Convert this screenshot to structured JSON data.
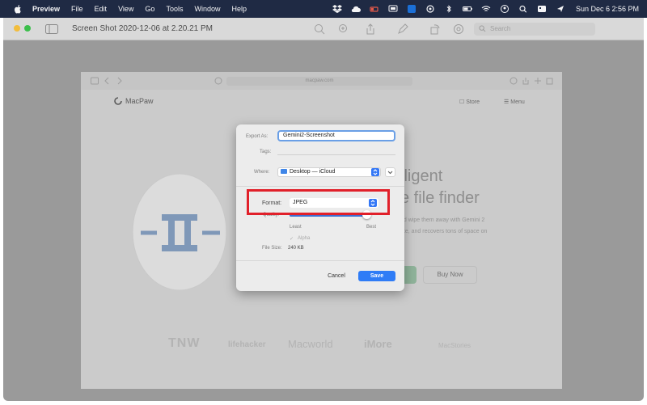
{
  "menubar": {
    "app_name": "Preview",
    "menus": [
      "File",
      "Edit",
      "View",
      "Go",
      "Tools",
      "Window",
      "Help"
    ],
    "clock": "Sun Dec 6  2:56 PM",
    "status_icons": [
      "dropbox-icon",
      "cloud-icon",
      "battery-monitor-icon",
      "screen-mirror-icon",
      "creative-cloud-icon",
      "sync-icon",
      "bluetooth-icon",
      "battery-icon",
      "wifi-icon",
      "user-icon",
      "search-icon",
      "control-center-icon",
      "siri-icon"
    ]
  },
  "window": {
    "title": "Screen Shot 2020-12-06 at 2.20.21 PM",
    "search_placeholder": "Search"
  },
  "webpage": {
    "url": "macpaw.com",
    "logo": "MacPaw",
    "store_label": "Store",
    "menu_label": "Menu",
    "hero_line1": "lligent",
    "hero_line2": "e file finder",
    "hero_sub1": "nd wipe them away with Gemini 2",
    "hero_sub2": "ate, and recovers tons of space on",
    "buy_label": "Buy Now",
    "brands": [
      "TNW",
      "lifehacker",
      "Macworld",
      "iMore",
      "MacStories"
    ]
  },
  "dialog": {
    "export_as_label": "Export As:",
    "export_as_value": "Gemini2-Screenshot",
    "tags_label": "Tags:",
    "where_label": "Where:",
    "where_value": "Desktop — iCloud",
    "format_label": "Format:",
    "format_value": "JPEG",
    "quality_label": "Quality:",
    "quality_min": "Least",
    "quality_max": "Best",
    "quality_value": 0.95,
    "alpha_label": "Alpha",
    "filesize_label": "File Size:",
    "filesize_value": "240 KB",
    "cancel_label": "Cancel",
    "save_label": "Save",
    "accent_color": "#2f7cf6"
  },
  "annotation": {
    "highlight_color": "#e1202a"
  }
}
